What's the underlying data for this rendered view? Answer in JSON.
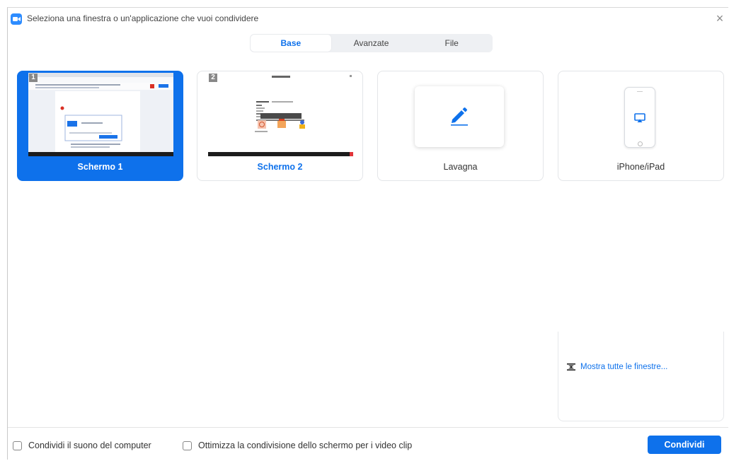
{
  "window": {
    "title": "Seleziona una finestra o un'applicazione che vuoi condividere",
    "close_symbol": "×"
  },
  "tabs": [
    {
      "label": "Base",
      "active": true
    },
    {
      "label": "Avanzate",
      "active": false
    },
    {
      "label": "File",
      "active": false
    }
  ],
  "cards": [
    {
      "label": "Schermo 1",
      "badge": "1",
      "selected": true
    },
    {
      "label": "Schermo 2",
      "badge": "2",
      "selected": false
    },
    {
      "label": "Lavagna",
      "icon": "pencil-icon"
    },
    {
      "label": "iPhone/iPad",
      "icon": "airplay-icon"
    }
  ],
  "show_all": {
    "label": "Mostra tutte le finestre...",
    "icon": "expand-icon"
  },
  "footer": {
    "option_sound": "Condividi il suono del computer",
    "option_optimize": "Ottimizza la condivisione dello schermo per i video clip",
    "share_label": "Condividi"
  },
  "colors": {
    "accent": "#0e71eb",
    "app_icon": "#2d8cff"
  }
}
